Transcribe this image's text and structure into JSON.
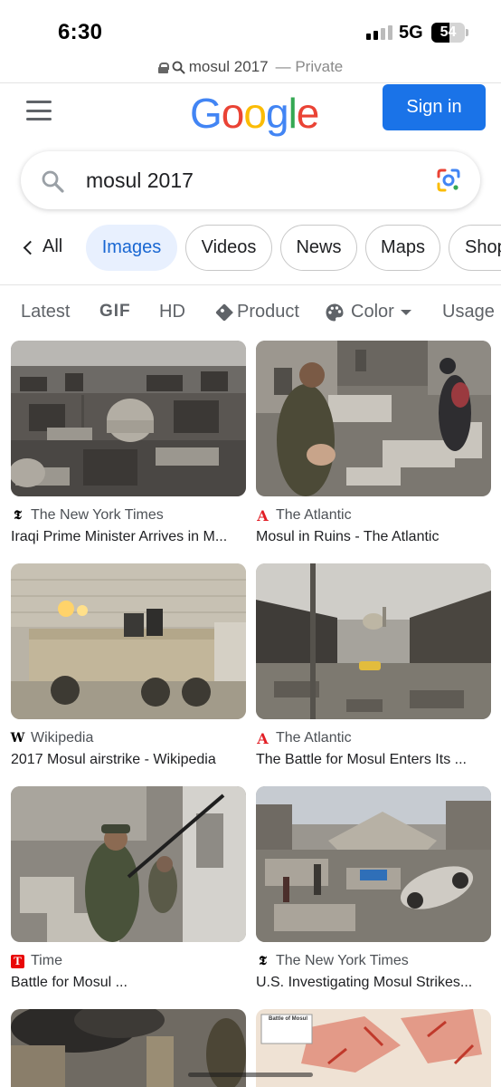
{
  "status_bar": {
    "time": "6:30",
    "network": "5G",
    "battery": "54",
    "battery_fraction": 0.54
  },
  "browser": {
    "url_text": "mosul 2017",
    "mode_text": "— Private"
  },
  "header": {
    "sign_in_label": "Sign in"
  },
  "search": {
    "query": "mosul 2017"
  },
  "tabs": {
    "back_label": "All",
    "items": [
      "Images",
      "Videos",
      "News",
      "Maps",
      "Shop"
    ]
  },
  "filters": [
    "Latest",
    "GIF",
    "HD",
    "Product",
    "Color",
    "Usage"
  ],
  "results": [
    {
      "source": "The New York Times",
      "title": "Iraqi Prime Minister Arrives in M..."
    },
    {
      "source": "The Atlantic",
      "title": "Mosul in Ruins - The Atlantic"
    },
    {
      "source": "Wikipedia",
      "title": "2017 Mosul airstrike - Wikipedia"
    },
    {
      "source": "The Atlantic",
      "title": "The Battle for Mosul Enters Its ..."
    },
    {
      "source": "Time",
      "title": "Battle for Mosul ..."
    },
    {
      "source": "The New York Times",
      "title": "U.S. Investigating Mosul Strikes..."
    }
  ],
  "partial_result_map_label": "Battle of Mosul",
  "colors": {
    "accent": "#1a73e8",
    "chip_active_bg": "#e8f0fe",
    "chip_active_text": "#1967d2"
  }
}
